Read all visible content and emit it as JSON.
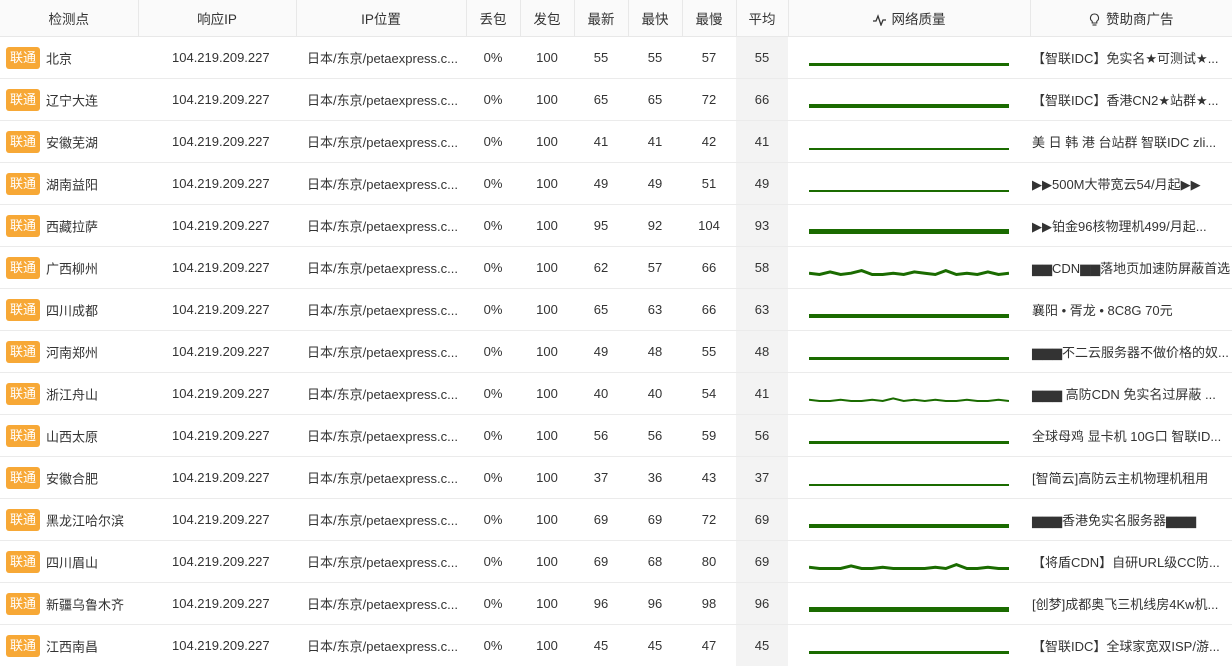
{
  "headers": [
    "检测点",
    "响应IP",
    "IP位置",
    "丢包",
    "发包",
    "最新",
    "最快",
    "最慢",
    "平均",
    "网络质量",
    "赞助商广告"
  ],
  "icons": {
    "quality": "pulse-icon",
    "sponsor": "lightbulb-icon"
  },
  "colors": {
    "badge": "#f7a836",
    "spark": "#1a6b00"
  },
  "rows": [
    {
      "isp": "联通",
      "loc": "北京",
      "ip": "104.219.209.227",
      "pos": "日本/东京/petaexpress.c...",
      "loss": "0%",
      "sent": "100",
      "last": "55",
      "best": "55",
      "worst": "57",
      "avg": "55",
      "ad": "【智联IDC】免实名★可测试★...",
      "spark": [
        0,
        0,
        0,
        0,
        0,
        0,
        0,
        0,
        0,
        0,
        0,
        0,
        0,
        0,
        0,
        0,
        0,
        0,
        0,
        0
      ],
      "w": 3
    },
    {
      "isp": "联通",
      "loc": "辽宁大连",
      "ip": "104.219.209.227",
      "pos": "日本/东京/petaexpress.c...",
      "loss": "0%",
      "sent": "100",
      "last": "65",
      "best": "65",
      "worst": "72",
      "avg": "66",
      "ad": "【智联IDC】香港CN2★站群★...",
      "spark": [
        0,
        0,
        0,
        0,
        0,
        0,
        0,
        0,
        0,
        0,
        0,
        0,
        0,
        0,
        0,
        0,
        0,
        0,
        0,
        0
      ],
      "w": 4
    },
    {
      "isp": "联通",
      "loc": "安徽芜湖",
      "ip": "104.219.209.227",
      "pos": "日本/东京/petaexpress.c...",
      "loss": "0%",
      "sent": "100",
      "last": "41",
      "best": "41",
      "worst": "42",
      "avg": "41",
      "ad": "美 日 韩 港 台站群 智联IDC zli...",
      "spark": [
        0,
        0,
        0,
        0,
        0,
        0,
        0,
        0,
        0,
        0,
        0,
        0,
        0,
        0,
        0,
        0,
        0,
        0,
        0,
        0
      ],
      "w": 2
    },
    {
      "isp": "联通",
      "loc": "湖南益阳",
      "ip": "104.219.209.227",
      "pos": "日本/东京/petaexpress.c...",
      "loss": "0%",
      "sent": "100",
      "last": "49",
      "best": "49",
      "worst": "51",
      "avg": "49",
      "ad": "▶▶500M大带宽云54/月起▶▶",
      "spark": [
        0,
        0,
        0,
        0,
        0,
        0,
        0,
        0,
        0,
        0,
        0,
        0,
        0,
        0,
        0,
        0,
        0,
        0,
        0,
        0
      ],
      "w": 2
    },
    {
      "isp": "联通",
      "loc": "西藏拉萨",
      "ip": "104.219.209.227",
      "pos": "日本/东京/petaexpress.c...",
      "loss": "0%",
      "sent": "100",
      "last": "95",
      "best": "92",
      "worst": "104",
      "avg": "93",
      "ad": "▶▶铂金96核物理机499/月起...",
      "spark": [
        0,
        0,
        0,
        0,
        0,
        0,
        0,
        0,
        0,
        0,
        0,
        0,
        0,
        0,
        0,
        0,
        0,
        0,
        0,
        0
      ],
      "w": 5
    },
    {
      "isp": "联通",
      "loc": "广西柳州",
      "ip": "104.219.209.227",
      "pos": "日本/东京/petaexpress.c...",
      "loss": "0%",
      "sent": "100",
      "last": "62",
      "best": "57",
      "worst": "66",
      "avg": "58",
      "ad": "▆▆CDN▆▆落地页加速防屏蔽首选",
      "spark": [
        1,
        0,
        2,
        0,
        1,
        3,
        0,
        0,
        1,
        0,
        2,
        1,
        0,
        3,
        0,
        1,
        0,
        2,
        0,
        1
      ],
      "w": 3
    },
    {
      "isp": "联通",
      "loc": "四川成都",
      "ip": "104.219.209.227",
      "pos": "日本/东京/petaexpress.c...",
      "loss": "0%",
      "sent": "100",
      "last": "65",
      "best": "63",
      "worst": "66",
      "avg": "63",
      "ad": "襄阳 • 胥龙 • 8C8G 70元",
      "spark": [
        0,
        0,
        0,
        0,
        0,
        0,
        0,
        0,
        0,
        0,
        0,
        0,
        0,
        0,
        0,
        0,
        0,
        0,
        0,
        0
      ],
      "w": 4
    },
    {
      "isp": "联通",
      "loc": "河南郑州",
      "ip": "104.219.209.227",
      "pos": "日本/东京/petaexpress.c...",
      "loss": "0%",
      "sent": "100",
      "last": "49",
      "best": "48",
      "worst": "55",
      "avg": "48",
      "ad": "▆▆▆不二云服务器不做价格的奴...",
      "spark": [
        0,
        0,
        0,
        0,
        0,
        0,
        0,
        0,
        0,
        0,
        0,
        0,
        0,
        0,
        0,
        0,
        0,
        0,
        0,
        0
      ],
      "w": 3
    },
    {
      "isp": "联通",
      "loc": "浙江舟山",
      "ip": "104.219.209.227",
      "pos": "日本/东京/petaexpress.c...",
      "loss": "0%",
      "sent": "100",
      "last": "40",
      "best": "40",
      "worst": "54",
      "avg": "41",
      "ad": "▆▆▆ 高防CDN 免实名过屏蔽 ...",
      "spark": [
        1,
        0,
        0,
        1,
        0,
        0,
        1,
        0,
        2,
        0,
        1,
        0,
        1,
        0,
        0,
        1,
        0,
        0,
        1,
        0
      ],
      "w": 2
    },
    {
      "isp": "联通",
      "loc": "山西太原",
      "ip": "104.219.209.227",
      "pos": "日本/东京/petaexpress.c...",
      "loss": "0%",
      "sent": "100",
      "last": "56",
      "best": "56",
      "worst": "59",
      "avg": "56",
      "ad": "全球母鸡 显卡机 10G口 智联ID...",
      "spark": [
        0,
        0,
        0,
        0,
        0,
        0,
        0,
        0,
        0,
        0,
        0,
        0,
        0,
        0,
        0,
        0,
        0,
        0,
        0,
        0
      ],
      "w": 3
    },
    {
      "isp": "联通",
      "loc": "安徽合肥",
      "ip": "104.219.209.227",
      "pos": "日本/东京/petaexpress.c...",
      "loss": "0%",
      "sent": "100",
      "last": "37",
      "best": "36",
      "worst": "43",
      "avg": "37",
      "ad": "[智简云]高防云主机物理机租用",
      "spark": [
        0,
        0,
        0,
        0,
        0,
        0,
        0,
        0,
        0,
        0,
        0,
        0,
        0,
        0,
        0,
        0,
        0,
        0,
        0,
        0
      ],
      "w": 2
    },
    {
      "isp": "联通",
      "loc": "黑龙江哈尔滨",
      "ip": "104.219.209.227",
      "pos": "日本/东京/petaexpress.c...",
      "loss": "0%",
      "sent": "100",
      "last": "69",
      "best": "69",
      "worst": "72",
      "avg": "69",
      "ad": "▆▆▆香港免实名服务器▆▆▆",
      "spark": [
        0,
        0,
        0,
        0,
        0,
        0,
        0,
        0,
        0,
        0,
        0,
        0,
        0,
        0,
        0,
        0,
        0,
        0,
        0,
        0
      ],
      "w": 4
    },
    {
      "isp": "联通",
      "loc": "四川眉山",
      "ip": "104.219.209.227",
      "pos": "日本/东京/petaexpress.c...",
      "loss": "0%",
      "sent": "100",
      "last": "69",
      "best": "68",
      "worst": "80",
      "avg": "69",
      "ad": "【将盾CDN】自研URL级CC防...",
      "spark": [
        1,
        0,
        0,
        0,
        2,
        0,
        0,
        1,
        0,
        0,
        0,
        0,
        1,
        0,
        3,
        0,
        0,
        1,
        0,
        0
      ],
      "w": 3
    },
    {
      "isp": "联通",
      "loc": "新疆乌鲁木齐",
      "ip": "104.219.209.227",
      "pos": "日本/东京/petaexpress.c...",
      "loss": "0%",
      "sent": "100",
      "last": "96",
      "best": "96",
      "worst": "98",
      "avg": "96",
      "ad": "[创梦]成都奥飞三机线房4Kw机...",
      "spark": [
        0,
        0,
        0,
        0,
        0,
        0,
        0,
        0,
        0,
        0,
        0,
        0,
        0,
        0,
        0,
        0,
        0,
        0,
        0,
        0
      ],
      "w": 5
    },
    {
      "isp": "联通",
      "loc": "江西南昌",
      "ip": "104.219.209.227",
      "pos": "日本/东京/petaexpress.c...",
      "loss": "0%",
      "sent": "100",
      "last": "45",
      "best": "45",
      "worst": "47",
      "avg": "45",
      "ad": "【智联IDC】全球家宽双ISP/游...",
      "spark": [
        0,
        0,
        0,
        0,
        0,
        0,
        0,
        0,
        0,
        0,
        0,
        0,
        0,
        0,
        0,
        0,
        0,
        0,
        0,
        0
      ],
      "w": 3
    }
  ]
}
